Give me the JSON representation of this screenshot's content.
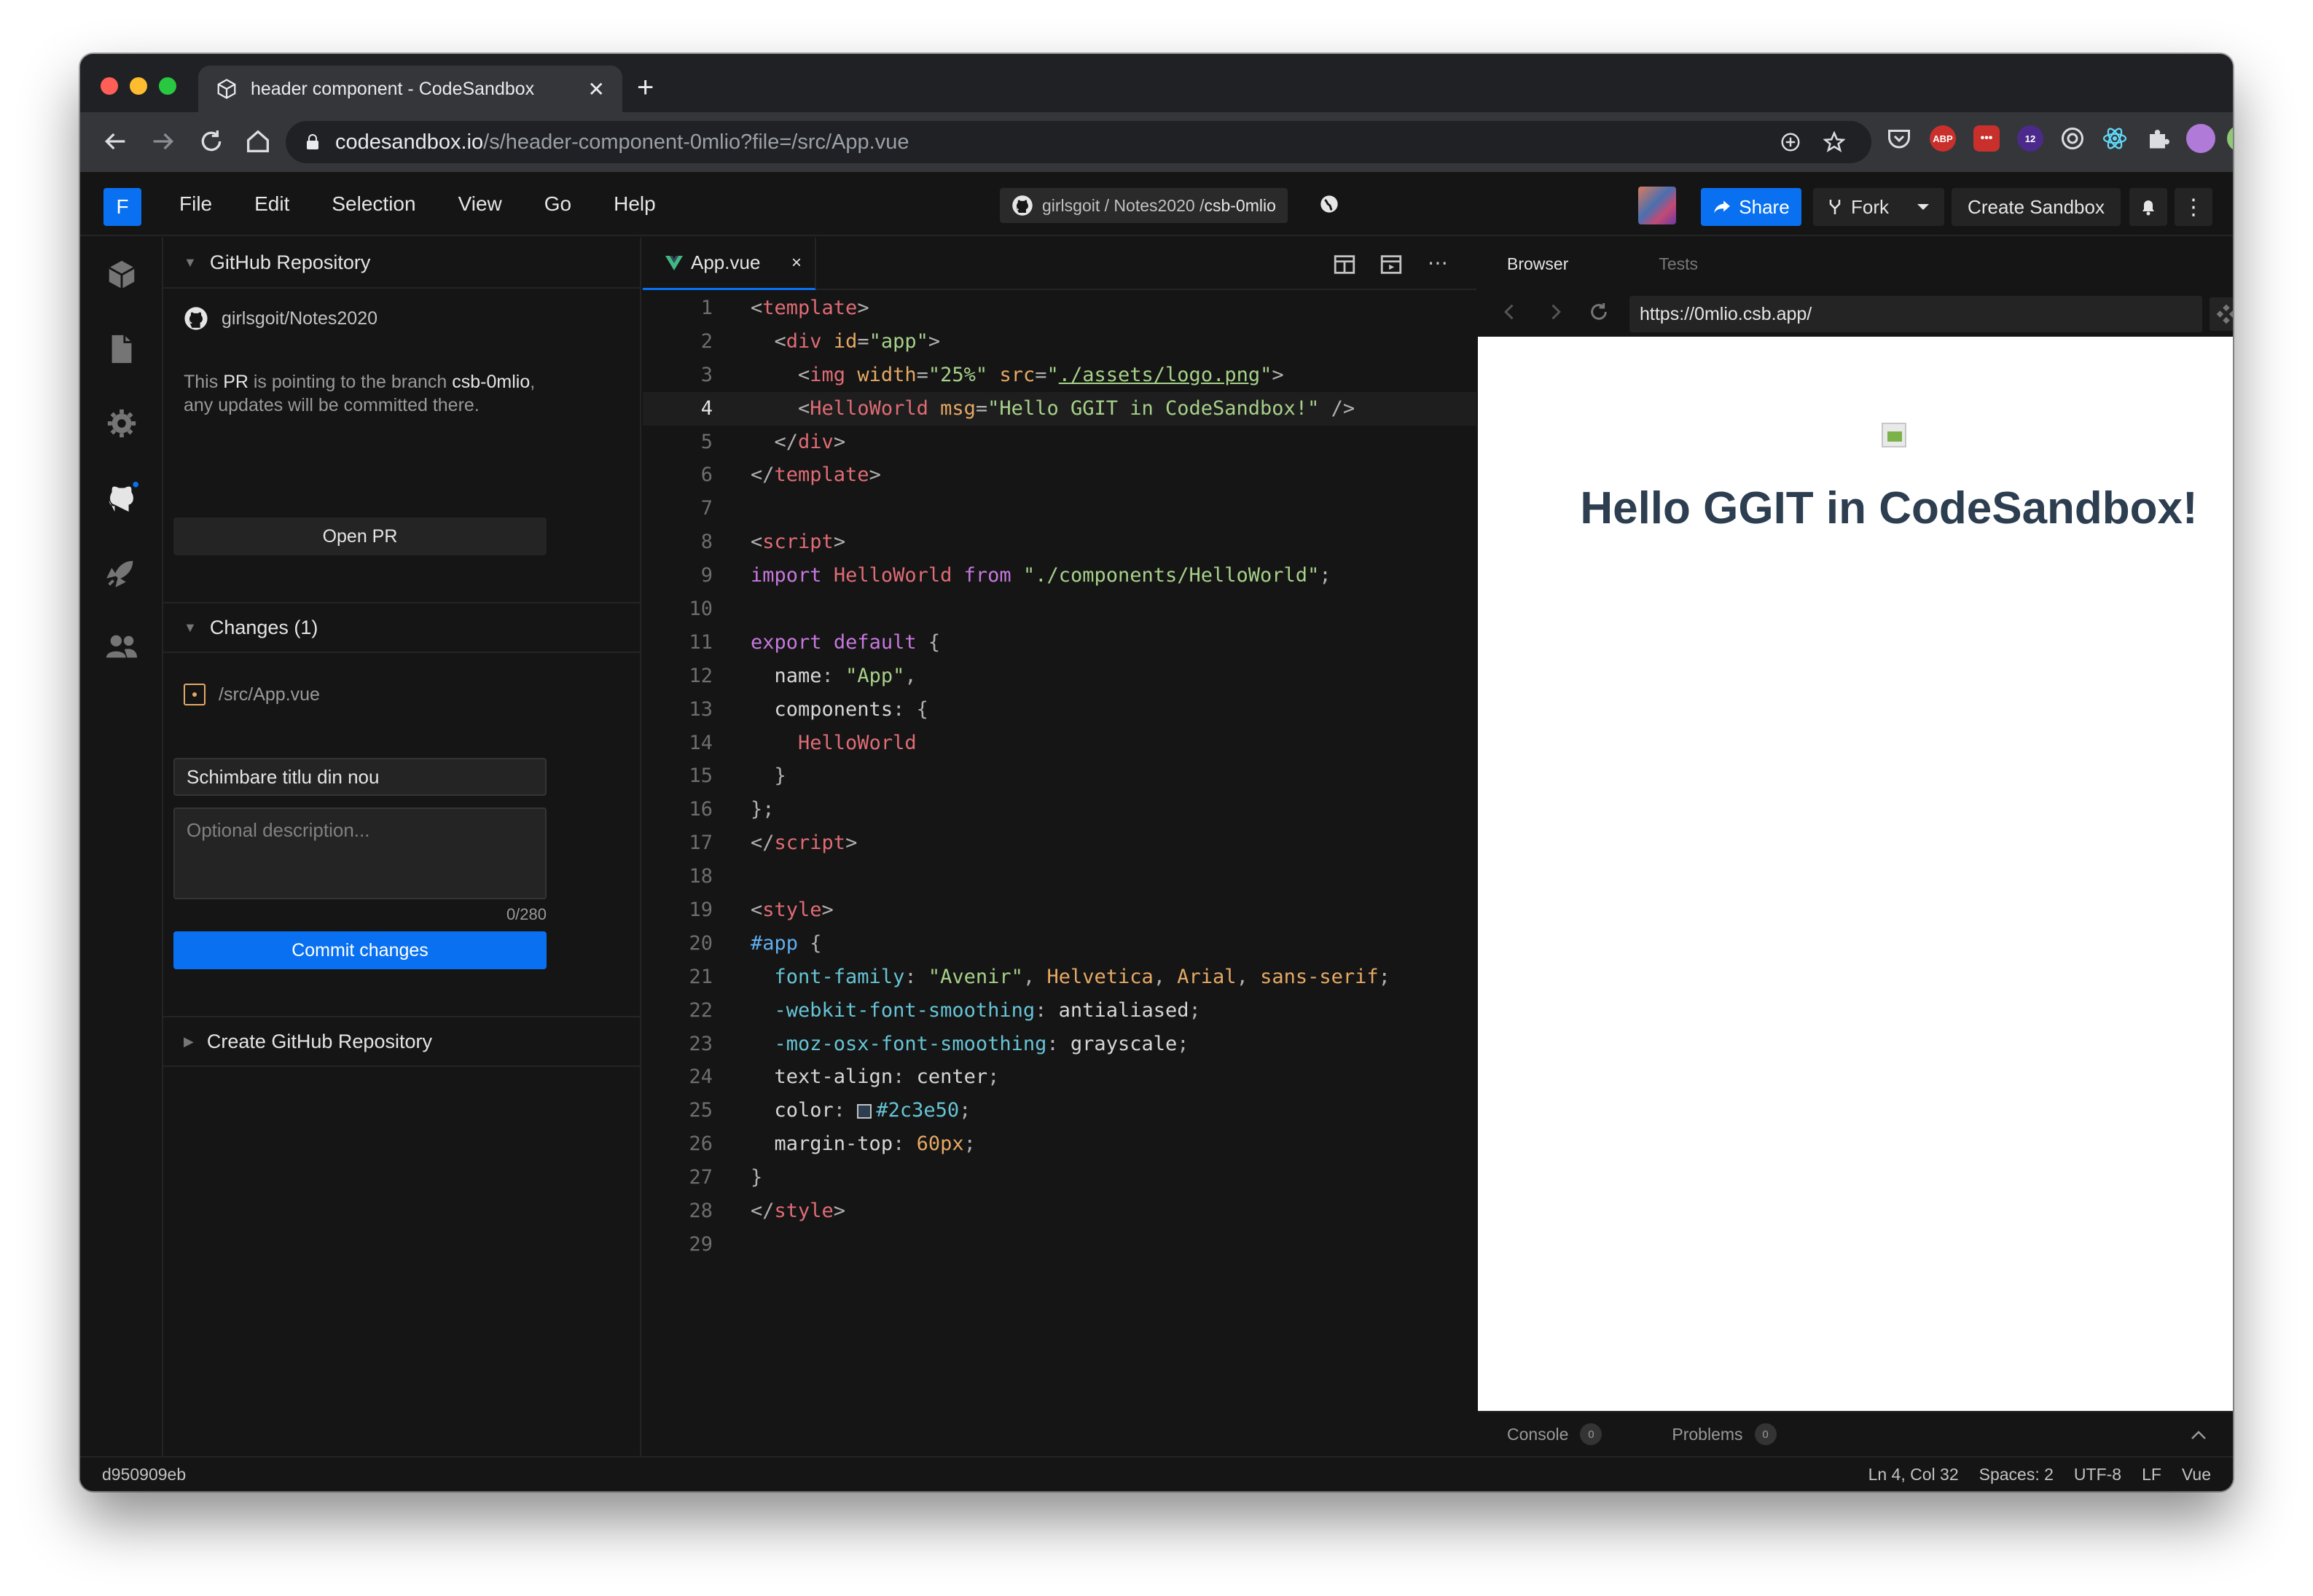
{
  "browser": {
    "tab_title": "header component - CodeSandbox",
    "new_tab": "+",
    "tab_close": "✕",
    "url_host": "codesandbox.io",
    "url_path": "/s/header-component-0mlio?file=/src/App.vue",
    "extension_badge": "12",
    "extension_abp": "ABP"
  },
  "csb": {
    "logo_letter": "F",
    "menu": [
      "File",
      "Edit",
      "Selection",
      "View",
      "Go",
      "Help"
    ],
    "repo_owner": "girlsgoit / Notes2020 / ",
    "repo_branch": "csb-0mlio",
    "share_label": "Share",
    "fork_label": "Fork",
    "create_label": "Create Sandbox"
  },
  "sidebar": {
    "github_section": "GitHub Repository",
    "repo_name": "girlsgoit/Notes2020",
    "pr_note_1": "This ",
    "pr_note_pr": "PR",
    "pr_note_2": " is pointing to the branch ",
    "pr_note_branch": "csb-0mlio",
    "pr_note_3": ", any updates will be committed there.",
    "open_pr": "Open PR",
    "changes_section": "Changes (1)",
    "changed_file": "/src/App.vue",
    "commit_title": "Schimbare titlu din nou",
    "description_placeholder": "Optional description...",
    "char_count": "0/280",
    "commit_button": "Commit changes",
    "create_repo_section": "Create GitHub Repository"
  },
  "editor": {
    "tab_name": "App.vue",
    "tab_close": "×",
    "active_line": 4
  },
  "preview": {
    "tab_browser": "Browser",
    "tab_tests": "Tests",
    "url": "https://0mlio.csb.app/",
    "heading": "Hello GGIT in CodeSandbox!",
    "console_label": "Console",
    "console_count": "0",
    "problems_label": "Problems",
    "problems_count": "0"
  },
  "status": {
    "commit": "d950909eb",
    "position": "Ln 4, Col 32",
    "spaces": "Spaces: 2",
    "encoding": "UTF-8",
    "eol": "LF",
    "language": "Vue"
  },
  "colors": {
    "accent": "#0971f1",
    "bg": "#151515",
    "vue_heading": "#2c3e50"
  }
}
